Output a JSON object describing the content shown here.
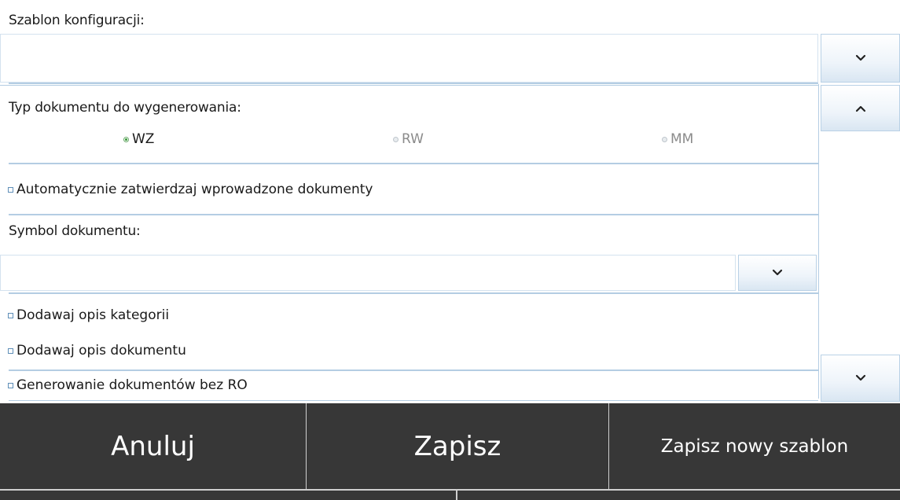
{
  "template": {
    "label": "Szablon konfiguracji:",
    "value": ""
  },
  "document_type": {
    "label": "Typ dokumentu do wygenerowania:",
    "options": [
      {
        "label": "WZ",
        "selected": true,
        "enabled": true
      },
      {
        "label": "RW",
        "selected": false,
        "enabled": false
      },
      {
        "label": "MM",
        "selected": false,
        "enabled": false
      }
    ]
  },
  "auto_confirm": {
    "label": "Automatycznie zatwierdzaj wprowadzone dokumenty",
    "checked": false
  },
  "document_symbol": {
    "label": "Symbol dokumentu:",
    "value": ""
  },
  "options": {
    "category_description": {
      "label": "Dodawaj opis kategorii",
      "checked": false
    },
    "document_description": {
      "label": "Dodawaj opis dokumentu",
      "checked": false
    },
    "generate_without_ro": {
      "label": "Generowanie dokumentów bez RO",
      "checked": false
    }
  },
  "footer": {
    "cancel_label": "Anuluj",
    "save_label": "Zapisz",
    "save_new_template_label": "Zapisz nowy szablon"
  },
  "icons": {
    "dropdown": "chevron-down-icon",
    "scroll_up": "chevron-up-icon",
    "scroll_down": "chevron-down-icon"
  },
  "colors": {
    "footer_background": "#373737",
    "footer_text": "#ffffff",
    "border_accent": "#b4cde3",
    "selected_radio": "#3c9c3c"
  }
}
